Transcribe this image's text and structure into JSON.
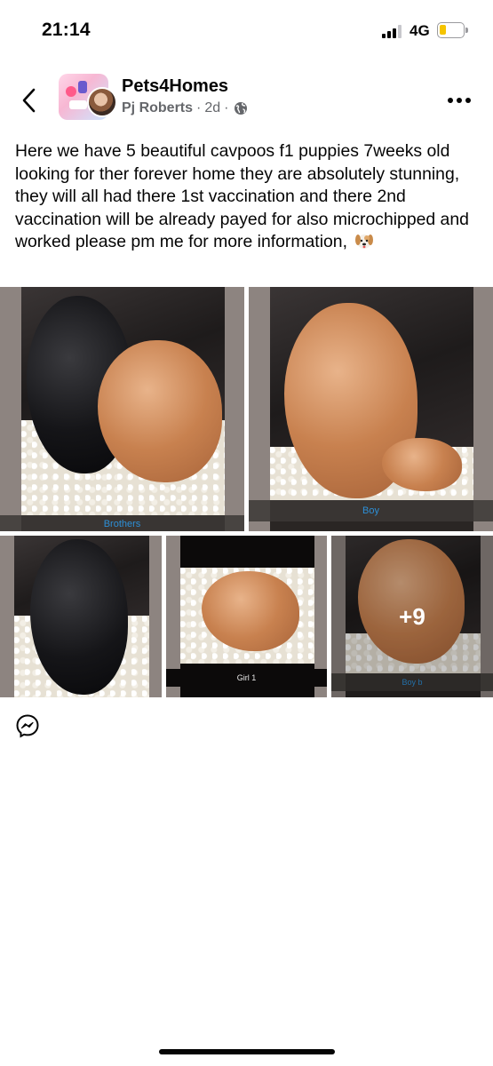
{
  "status_bar": {
    "time": "21:14",
    "network": "4G",
    "battery_level": 0.25
  },
  "header": {
    "back_icon": "chevron-left-icon",
    "group_name": "Pets4Homes",
    "author": "Pj Roberts",
    "separator": "·",
    "time_ago": "2d",
    "privacy_icon": "globe-icon",
    "more_icon": "more-horizontal-icon"
  },
  "post": {
    "text": "Here we have 5 beautiful cavpoos f1 puppies 7weeks old looking for ther forever home they are absolutely stunning, they will all had there 1st vaccination and there 2nd vaccination will be already payed for also microchipped  and worked please pm me for more information,",
    "emoji": "dog-face-icon"
  },
  "photos": [
    {
      "caption": "Brothers"
    },
    {
      "caption": "Boy"
    },
    {
      "caption": ""
    },
    {
      "caption": "Girl 1"
    },
    {
      "caption": "Boy b",
      "overlay": "+9"
    }
  ],
  "actions": {
    "messenger_icon": "messenger-icon"
  },
  "colors": {
    "text_primary": "#050505",
    "text_secondary": "#65676b",
    "caption_blue": "#2d8fd6",
    "battery_yellow": "#f5c400"
  }
}
